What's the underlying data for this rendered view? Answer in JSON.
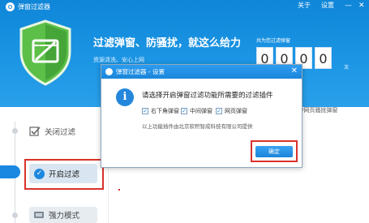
{
  "app": {
    "title": "弹窗过滤器",
    "top_links": {
      "about": "关于",
      "settings": "设置"
    },
    "window_controls": {
      "minimize": "—",
      "close": "✕"
    }
  },
  "header": {
    "headline": "过滤弹窗、防骚扰，就这么给力",
    "subline": "资源清洗、安心上网",
    "count_label": "共为您过滤弹窗",
    "digits": [
      "0",
      "0",
      "0",
      "0"
    ],
    "count_unit": "次"
  },
  "modes": {
    "close": "关闭过滤",
    "open": "开启过滤",
    "strong": "强力模式"
  },
  "background_text": "/网页骚扰弹窗",
  "dialog": {
    "title": "弹窗过滤器 - 设置",
    "close": "✕",
    "message": "请选择开启弹窗过滤功能所需要的过滤插件",
    "options": [
      {
        "label": "右下角弹窗",
        "checked": true
      },
      {
        "label": "中间弹窗",
        "checked": true
      },
      {
        "label": "网页弹窗",
        "checked": true
      }
    ],
    "note": "以上功能插件由北京软积智成科技有限公司提供",
    "ok": "确定"
  },
  "colors": {
    "header_blue": "#1b95e4",
    "highlight_red": "#d9322b",
    "shield_green": "#4fb14a"
  }
}
